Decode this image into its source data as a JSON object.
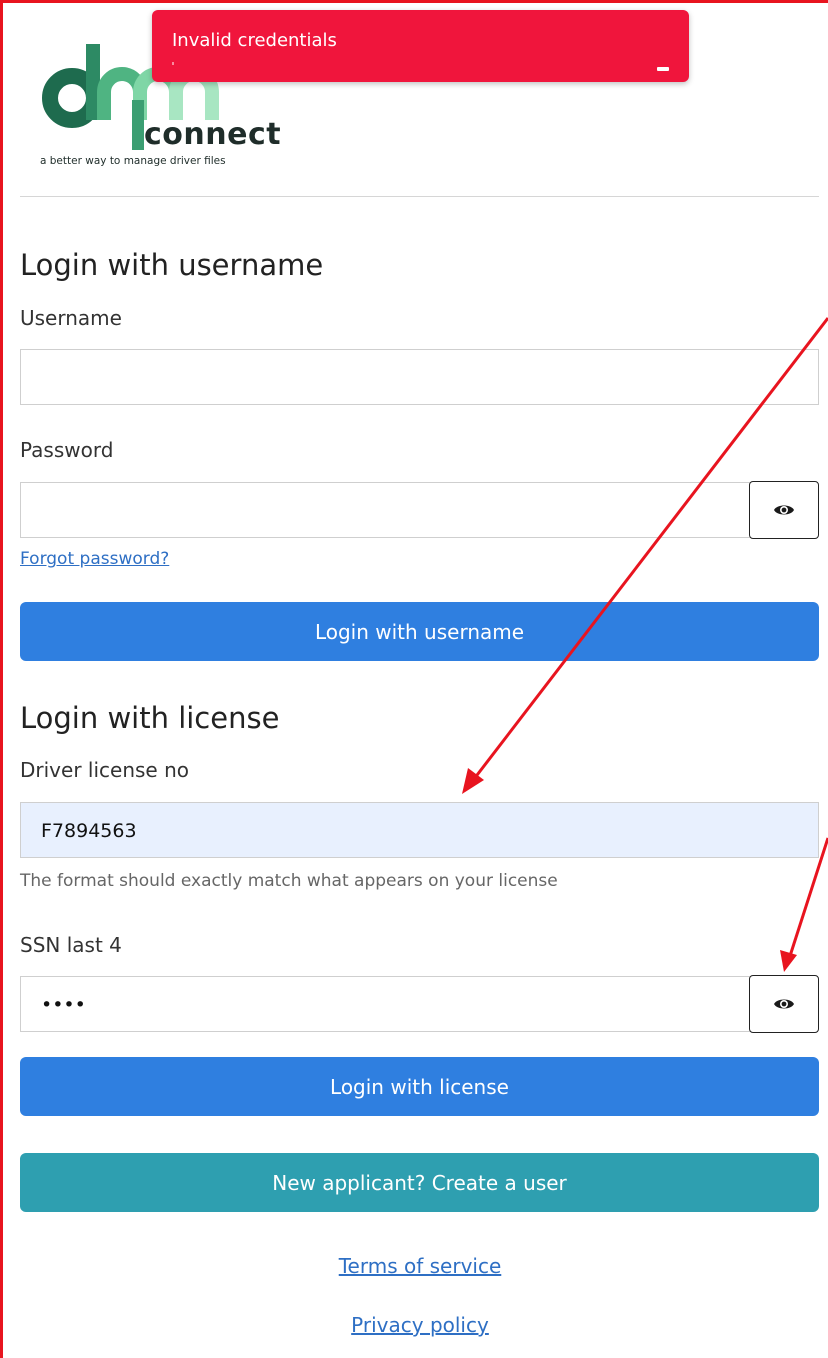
{
  "toast": {
    "message": "Invalid credentials"
  },
  "logo": {
    "wordmark": "connect",
    "tagline": "a better way to manage driver files"
  },
  "username_section": {
    "heading": "Login with username",
    "username_label": "Username",
    "username_value": "",
    "password_label": "Password",
    "password_value": "",
    "forgot_link": "Forgot password?",
    "submit_label": "Login with username"
  },
  "license_section": {
    "heading": "Login with license",
    "license_label": "Driver license no",
    "license_value": "F7894563",
    "license_hint": "The format should exactly match what appears on your license",
    "ssn_label": "SSN last 4",
    "ssn_value": "••••",
    "submit_label": "Login with license"
  },
  "create_user_label": "New applicant? Create a user",
  "footer": {
    "terms": "Terms of service",
    "privacy": "Privacy policy"
  },
  "colors": {
    "primary": "#2f7fe0",
    "secondary": "#2e9fb0",
    "error": "#f0153c",
    "annotation": "#e8141f",
    "logo_green_dark": "#1e6b4e",
    "logo_green_light": "#7fd6a6"
  },
  "icons": {
    "toggle_visibility": "eye-icon",
    "close": "close-icon"
  }
}
